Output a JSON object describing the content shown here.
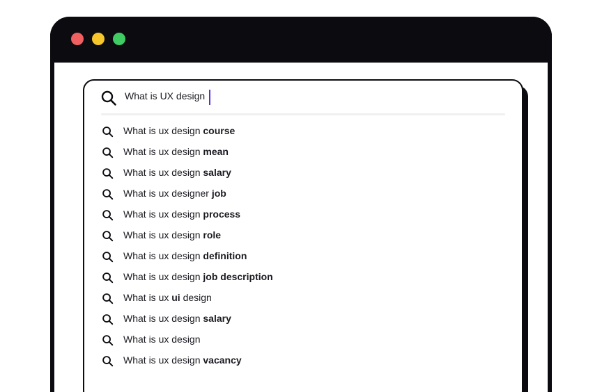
{
  "window": {
    "traffic_lights": {
      "close": "#f06061",
      "minimize": "#f6c62b",
      "maximize": "#3fcc63"
    },
    "frame_color": "#0b0b10",
    "accent_caret_color": "#5a2fd8"
  },
  "search": {
    "query": "What is UX design",
    "icon": "search-icon"
  },
  "suggestions": [
    {
      "prefix": "What is ux design ",
      "bold": "course",
      "suffix": ""
    },
    {
      "prefix": "What is ux design ",
      "bold": "mean",
      "suffix": ""
    },
    {
      "prefix": "What is ux design ",
      "bold": "salary",
      "suffix": ""
    },
    {
      "prefix": "What is ux designer ",
      "bold": "job",
      "suffix": ""
    },
    {
      "prefix": "What is ux design ",
      "bold": "process",
      "suffix": ""
    },
    {
      "prefix": "What is ux design ",
      "bold": "role",
      "suffix": ""
    },
    {
      "prefix": "What is ux design ",
      "bold": "definition",
      "suffix": ""
    },
    {
      "prefix": "What is ux design ",
      "bold": "job description",
      "suffix": ""
    },
    {
      "prefix": "What is ux ",
      "bold": "ui",
      "suffix": " design"
    },
    {
      "prefix": "What is ux design ",
      "bold": "salary",
      "suffix": ""
    },
    {
      "prefix": "What is ux design",
      "bold": "",
      "suffix": ""
    },
    {
      "prefix": "What is ux design ",
      "bold": "vacancy",
      "suffix": ""
    }
  ]
}
